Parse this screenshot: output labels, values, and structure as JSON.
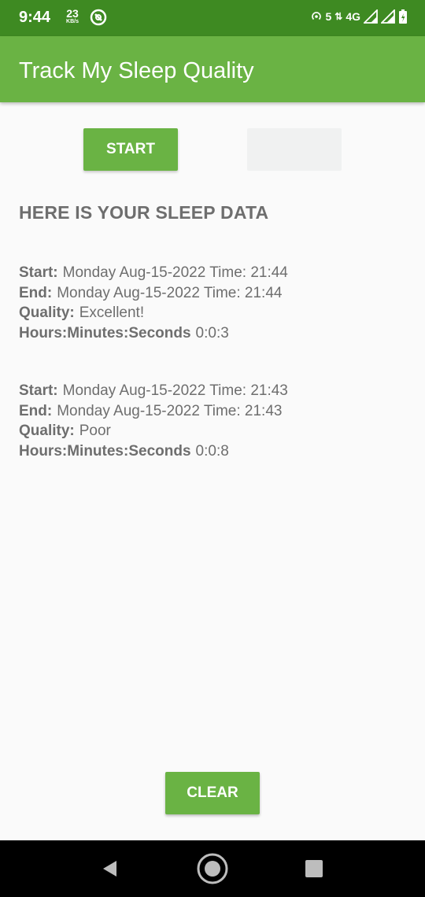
{
  "status_bar": {
    "time": "9:44",
    "speed_value": "23",
    "speed_unit": "KB/s",
    "hotspot_count": "5",
    "network": "4G",
    "icons": [
      "app-icon",
      "hotspot-icon",
      "signal-icon",
      "signal-icon",
      "battery-charging-icon"
    ]
  },
  "app_bar": {
    "title": "Track My Sleep Quality"
  },
  "controls": {
    "start_label": "START",
    "stop_label": ""
  },
  "heading": "HERE IS YOUR SLEEP DATA",
  "labels": {
    "start": "Start:",
    "end": "End:",
    "quality": "Quality:",
    "duration": "Hours:Minutes:Seconds"
  },
  "nights": [
    {
      "start": "Monday Aug-15-2022 Time: 21:44",
      "end": "Monday Aug-15-2022 Time: 21:44",
      "quality": "Excellent!",
      "duration": "0:0:3"
    },
    {
      "start": "Monday Aug-15-2022 Time: 21:43",
      "end": "Monday Aug-15-2022 Time: 21:43",
      "quality": "Poor",
      "duration": "0:0:8"
    }
  ],
  "clear_label": "CLEAR",
  "colors": {
    "status_bar": "#3e8a22",
    "primary": "#6ab344",
    "text": "#6e6e6e",
    "background": "#fafafa"
  },
  "nav_icons": [
    "back-icon",
    "home-icon",
    "recents-icon"
  ]
}
